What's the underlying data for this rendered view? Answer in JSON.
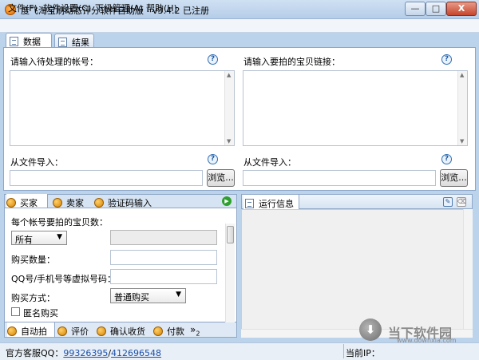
{
  "window": {
    "title": "度飞淘宝刷动态评分软件自助版 - v3.4.2 已注册",
    "min_glyph": "—",
    "max_glyph": "□",
    "close_glyph": "X"
  },
  "menu": [
    "文件(F)",
    "软件设置(C)",
    "下级管理(A)",
    "帮助(H)"
  ],
  "main_tabs": [
    "数据",
    "结果"
  ],
  "data_panel": {
    "accounts_label": "请输入待处理的帐号：",
    "links_label": "请输入要拍的宝贝链接：",
    "import_left_label": "从文件导入：",
    "import_right_label": "从文件导入：",
    "browse_label": "浏览...",
    "help_glyph": "?"
  },
  "buyer_tabs": [
    "买家",
    "卖家",
    "验证码输入"
  ],
  "buyer_form": {
    "count_label": "每个帐号要拍的宝贝数：",
    "count_select": "所有",
    "quantity_label": "购买数量：",
    "qq_label": "QQ号/手机号等虚拟号码：",
    "method_label": "购买方式：",
    "method_select": "普通购买",
    "anonymous_label": "匿名购买"
  },
  "bottom_tabs": [
    "自动拍",
    "评价",
    "确认收货",
    "付款"
  ],
  "bottom_tabs_more": "»",
  "bottom_tabs_more_count": "2",
  "run_info": {
    "tab_label": "运行信息"
  },
  "status": {
    "support_label": "官方客服QQ：",
    "qq1": "99326395",
    "separator": "/",
    "qq2": "412696548",
    "ip_label": "当前IP："
  },
  "watermark": {
    "logo_char": "⬇",
    "text": "当下软件园",
    "url": "www.downxia.com"
  }
}
